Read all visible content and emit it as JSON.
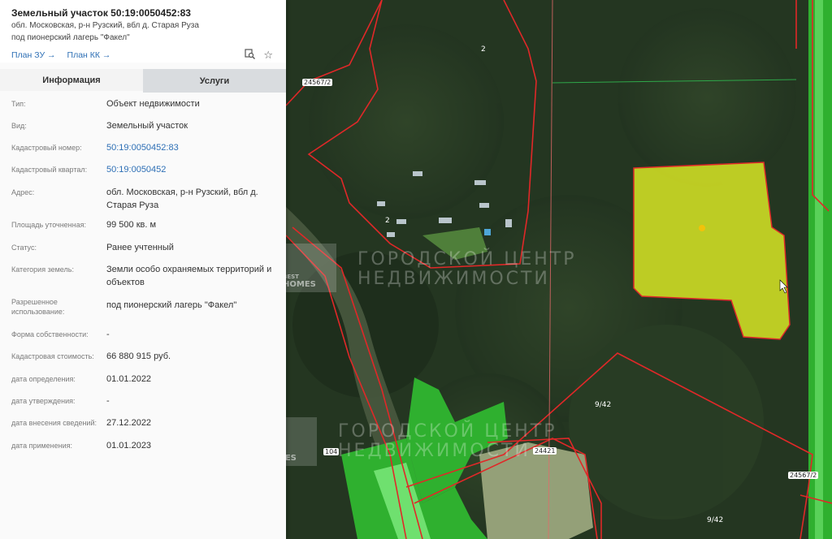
{
  "panel": {
    "title": "Земельный участок 50:19:0050452:83",
    "address_line": "обл. Московская, р-н Рузский, вбл д. Старая Руза",
    "usage_line": "под пионерский лагерь \"Факел\"",
    "plan_zu": "План ЗУ →",
    "plan_kk": "План КК →",
    "icons": {
      "search": "search-map-icon",
      "favorite": "star-icon"
    },
    "tabs": {
      "info": "Информация",
      "services": "Услуги"
    },
    "rows": [
      {
        "key": "Тип:",
        "value": "Объект недвижимости"
      },
      {
        "key": "Вид:",
        "value": "Земельный участок"
      },
      {
        "key": "Кадастровый номер:",
        "value": "50:19:0050452:83"
      },
      {
        "key": "Кадастровый квартал:",
        "value": "50:19:0050452"
      },
      {
        "key": "Адрес:",
        "value": "обл. Московская, р-н Рузский, вбл д. Старая Руза"
      },
      {
        "key": "Площадь уточненная:",
        "value": "99 500 кв. м"
      },
      {
        "key": "Статус:",
        "value": "Ранее учтенный"
      },
      {
        "key": "Категория земель:",
        "value": "Земли особо охраняемых территорий и объектов"
      },
      {
        "key": "Разрешенное использование:",
        "value": "под пионерский лагерь \"Факел\""
      },
      {
        "key": "Форма собственности:",
        "value": "-"
      },
      {
        "key": "Кадастровая стоимость:",
        "value": "66 880 915 руб."
      },
      {
        "key": "дата определения:",
        "value": "01.01.2022"
      },
      {
        "key": "дата утверждения:",
        "value": "-"
      },
      {
        "key": "дата внесения сведений:",
        "value": "27.12.2022"
      },
      {
        "key": "дата применения:",
        "value": "01.01.2023"
      }
    ]
  },
  "map": {
    "labels": {
      "l2a": "2",
      "l2b": "2",
      "l24567a": "24567/2",
      "l24567b": "24567/2",
      "l942a": "9/42",
      "l942b": "9/42",
      "l24421": "24421",
      "l104": "104"
    },
    "watermark": {
      "line1": "ГОРОДСКОЙ ЦЕНТР",
      "line2": "НЕДВИЖИМОСТИ",
      "logo_best": "BEST",
      "logo_homes": "HOMES"
    },
    "colors": {
      "forest": "#263a22",
      "parcel_border": "#e02828",
      "highlight_fill": "#d8e624",
      "green_zone": "#2fb02f"
    }
  }
}
